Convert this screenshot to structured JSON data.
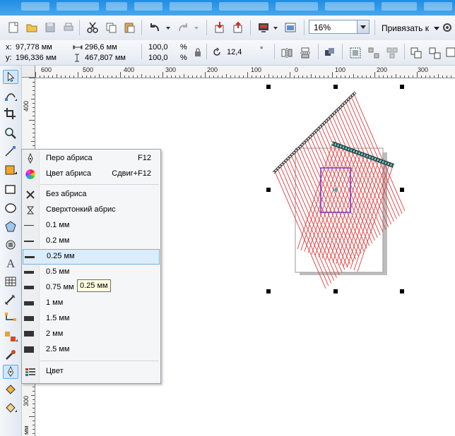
{
  "toolbar": {
    "zoom_value": "16%",
    "snap_label": "Привязать к"
  },
  "property_bar": {
    "x_label": "x:",
    "x_value": "97,778 мм",
    "y_label": "y:",
    "y_value": "196,336 мм",
    "width_value": "296,6 мм",
    "height_value": "467,807 мм",
    "scale_w": "100,0",
    "scale_h": "100,0",
    "scale_unit_w": "%",
    "scale_unit_h": "%",
    "rotation_value": "12,4",
    "rotation_unit": "°"
  },
  "ruler": {
    "h_labels": [
      "600",
      "500",
      "400",
      "300",
      "200",
      "100",
      "0",
      "100",
      "200",
      "300"
    ],
    "v_labels": [
      "400",
      "300",
      "мм"
    ]
  },
  "outline_menu": {
    "items": [
      {
        "label": "Перо абриса",
        "shortcut": "F12"
      },
      {
        "label": "Цвет абриса",
        "shortcut": "Сдвиг+F12"
      },
      {
        "label": "Без абриса",
        "shortcut": ""
      },
      {
        "label": "Сверхтонкий абрис",
        "shortcut": ""
      },
      {
        "label": "0.1 мм",
        "shortcut": ""
      },
      {
        "label": "0.2 мм",
        "shortcut": ""
      },
      {
        "label": "0.25 мм",
        "shortcut": ""
      },
      {
        "label": "0.5 мм",
        "shortcut": ""
      },
      {
        "label": "0.75 мм",
        "shortcut": ""
      },
      {
        "label": "1 мм",
        "shortcut": ""
      },
      {
        "label": "1.5 мм",
        "shortcut": ""
      },
      {
        "label": "2 мм",
        "shortcut": ""
      },
      {
        "label": "2.5 мм",
        "shortcut": ""
      },
      {
        "label": "Цвет",
        "shortcut": ""
      }
    ],
    "highlighted_index": 6
  },
  "tooltip": {
    "text": "0.25 мм"
  },
  "colors": {
    "accent": "#3d8ee0",
    "hatch_red": "#e23b3b",
    "selection_purple": "#7a2fd0"
  }
}
